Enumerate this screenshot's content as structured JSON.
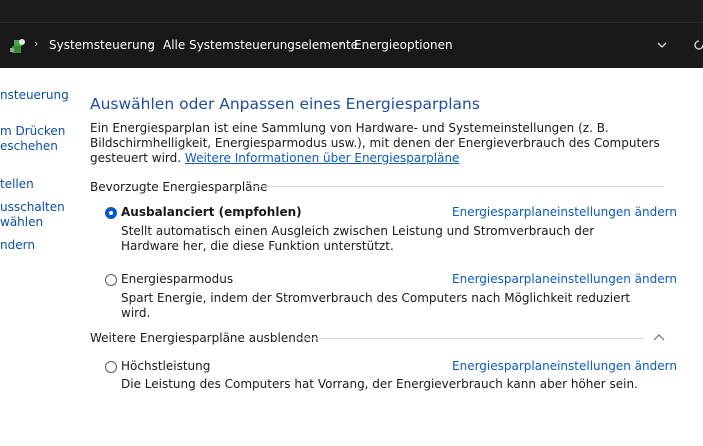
{
  "address_bar": {
    "breadcrumbs": [
      "Systemsteuerung",
      "Alle Systemsteuerungselemente",
      "Energieoptionen"
    ],
    "icon": "control-panel-icon"
  },
  "sidebar": {
    "items": [
      "nsteuerung",
      "m Drücken",
      "eschehen",
      "tellen",
      "usschalten",
      "wählen",
      "ndern"
    ]
  },
  "main": {
    "title": "Auswählen oder Anpassen eines Energiesparplans",
    "intro_text": "Ein Energiesparplan ist eine Sammlung von Hardware- und Systemeinstellungen (z. B. Bildschirmhelligkeit, Energiesparmodus usw.), mit denen der Energieverbrauch des Computers gesteuert wird. ",
    "intro_link": "Weitere Informationen über Energiesparpläne",
    "preferred_header": "Bevorzugte Energiesparpläne",
    "more_header": "Weitere Energiesparpläne ausblenden",
    "plans": [
      {
        "name": "Ausbalanciert (empfohlen)",
        "selected": true,
        "link": "Energiesparplaneinstellungen ändern",
        "description": "Stellt automatisch einen Ausgleich zwischen Leistung und Stromverbrauch der Hardware her, die diese Funktion unterstützt."
      },
      {
        "name": "Energiesparmodus",
        "selected": false,
        "link": "Energiesparplaneinstellungen ändern",
        "description": "Spart Energie, indem der Stromverbrauch des Computers nach Möglichkeit reduziert wird."
      },
      {
        "name": "Höchstleistung",
        "selected": false,
        "link": "Energiesparplaneinstellungen ändern",
        "description": "Die Leistung des Computers hat Vorrang, der Energieverbrauch kann aber höher sein."
      }
    ]
  },
  "colors": {
    "accent": "#0a59c9",
    "title": "#1e4ea2",
    "link": "#0a5bc4",
    "address_bg": "#191919"
  }
}
